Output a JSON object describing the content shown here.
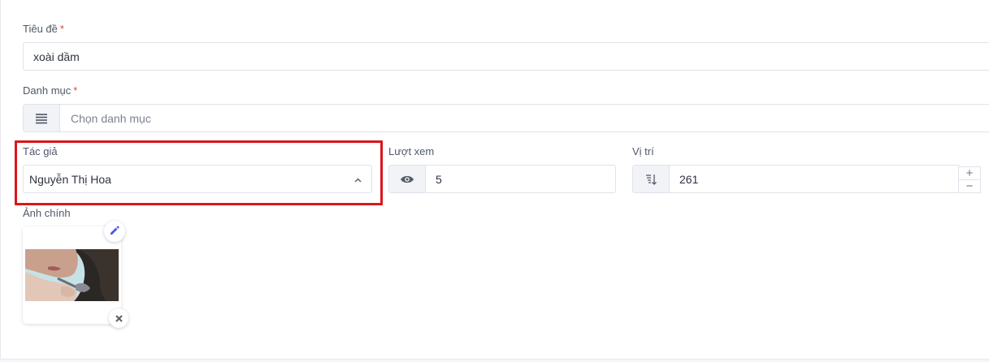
{
  "form": {
    "title": {
      "label": "Tiêu đề",
      "required_mark": "*",
      "value": "xoài dầm"
    },
    "category": {
      "label": "Danh mục",
      "required_mark": "*",
      "placeholder": "Chọn danh mục",
      "icon": "list-icon"
    },
    "author": {
      "label": "Tác giả",
      "value": "Nguyễn Thị Hoa",
      "icon": "chevron-up-icon"
    },
    "views": {
      "label": "Lượt xem",
      "value": "5",
      "icon": "eye-icon"
    },
    "position": {
      "label": "Vị trí",
      "value": "261",
      "icon": "sort-descending-icon",
      "increment": "+",
      "decrement": "−"
    },
    "main_image": {
      "label": "Ảnh chính",
      "edit_icon": "pencil-icon",
      "remove_icon": "close-icon"
    }
  },
  "colors": {
    "highlight": "#d9171c",
    "required": "#e0463e",
    "edit_icon": "#4a5be0"
  }
}
